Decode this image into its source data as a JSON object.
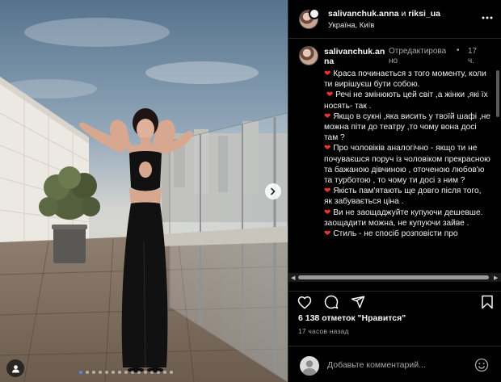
{
  "post": {
    "header": {
      "author": "salivanchuk.anna",
      "connector": "и",
      "coauthor": "riksi_ua",
      "location": "Україна, Київ"
    },
    "caption": {
      "username_part1": "salivanchuk.an",
      "username_part2": "na",
      "edited_part1": "Отредактирова",
      "edited_part2": "но",
      "separator": "•",
      "time_part1": "17",
      "time_part2": "ч.",
      "paragraphs": [
        "Краса починається з того моменту, коли ти вирішуєш бути собою.",
        "Речі не змінюють цей світ ,а жінки ,які їх носять- так .",
        "Якщо в сукні ,яка висить у твоїй шафі ,не можна піти до театру ,то чому вона досі там ?",
        "Про чоловіків аналогічно - якщо ти не почуваєшся поруч із чоловіком прекрасною та бажаною дівчиною , оточеною любов'ю та турботою , то чому ти досі з ним ?",
        "Якість пам'ятають ще довго після того,  як забувається ціна .",
        "Ви не заощаджуйте купуючи дешевше. заощадити можна,  не купуючи зайве .",
        "Стиль - не спосіб розповісти про"
      ]
    },
    "likes_text": "6 138 отметок \"Нравится\"",
    "time_ago": "17 часов назад",
    "comment_placeholder": "Добавьте комментарий...",
    "carousel": {
      "slides": 15,
      "active_index": 0
    },
    "colors": {
      "heart": "#e8362e",
      "active_dot": "#4a90e2"
    },
    "icons": [
      "more-icon",
      "heart-icon",
      "comment-icon",
      "share-icon",
      "bookmark-icon",
      "emoji-icon",
      "chevron-right-icon",
      "user-icon"
    ]
  }
}
